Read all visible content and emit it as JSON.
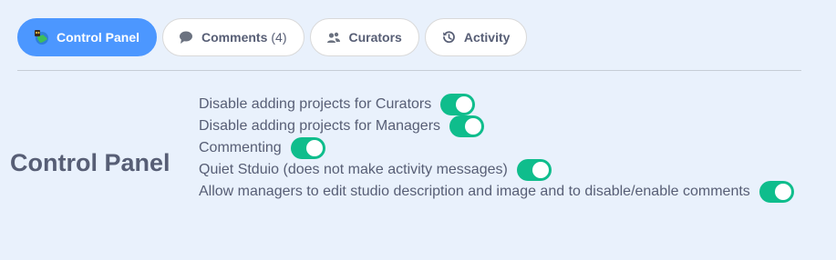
{
  "tabs": [
    {
      "label": "Control Panel",
      "icon": "globe-cat-icon",
      "active": true
    },
    {
      "label": "Comments",
      "count": "(4)",
      "icon": "speech-bubble-icon",
      "active": false
    },
    {
      "label": "Curators",
      "icon": "people-icon",
      "active": false
    },
    {
      "label": "Activity",
      "icon": "history-icon",
      "active": false
    }
  ],
  "panel": {
    "heading": "Control Panel"
  },
  "settings": [
    {
      "label": "Disable adding projects for Curators",
      "enabled": true
    },
    {
      "label": "Disable adding projects for Managers",
      "enabled": true
    },
    {
      "label": "Commenting",
      "enabled": true
    },
    {
      "label": "Quiet Stduio (does not make activity messages)",
      "enabled": true
    },
    {
      "label": "Allow managers to edit studio description and image and to disable/enable comments",
      "enabled": true
    }
  ],
  "colors": {
    "background": "#e9f1fc",
    "tab_active": "#4c97ff",
    "toggle_on": "#0fbd8c",
    "text": "#575e75"
  }
}
